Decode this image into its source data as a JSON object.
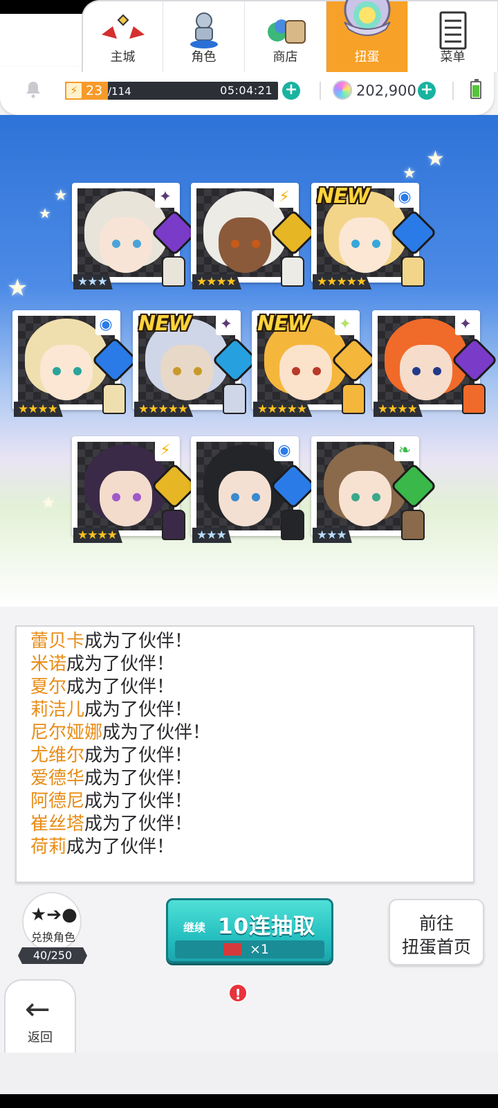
{
  "hud": {
    "stamina_current": "23",
    "stamina_max": "/114",
    "stamina_fraction": 0.2,
    "timer": "05:04:21",
    "gems": "202,900",
    "bolt_icon": "⚡"
  },
  "cards": [
    {
      "row": 1,
      "rarity": "★★★",
      "silver": true,
      "new": "",
      "element": "dark",
      "badge": "✦",
      "badge_color": "#5a3a78",
      "hair": "#e9e4da",
      "skin": "#f8e4d6",
      "eye": "#4aa3d8",
      "gem": "#7a3bc8"
    },
    {
      "row": 1,
      "rarity": "★★★★",
      "silver": false,
      "new": "",
      "element": "light",
      "badge": "⚡",
      "badge_color": "#f2b200",
      "hair": "#ecebe6",
      "skin": "#8b5a3a",
      "eye": "#c85a18",
      "gem": "#e7b625"
    },
    {
      "row": 1,
      "rarity": "★★★★★",
      "silver": false,
      "new": "NEW",
      "element": "water",
      "badge": "◉",
      "badge_color": "#2a7be8",
      "hair": "#f3d58a",
      "skin": "#fbe7d4",
      "eye": "#38a6d8",
      "gem": "#2a7be8"
    },
    {
      "row": 2,
      "rarity": "★★★★",
      "silver": false,
      "new": "",
      "element": "water",
      "badge": "◉",
      "badge_color": "#2a7be8",
      "hair": "#f0dfae",
      "skin": "#fbe7d4",
      "eye": "#2aa49a",
      "gem": "#2a7be8"
    },
    {
      "row": 2,
      "rarity": "★★★★★",
      "silver": false,
      "new": "NEW",
      "element": "dark",
      "badge": "✦",
      "badge_color": "#5a3a78",
      "hair": "#cfd6e8",
      "skin": "#e8d8c8",
      "eye": "#c89a2a",
      "gem": "#27a0e0"
    },
    {
      "row": 2,
      "rarity": "★★★★★",
      "silver": false,
      "new": "NEW",
      "element": "light",
      "badge": "✦",
      "badge_color": "#b7e06a",
      "hair": "#f5b63c",
      "skin": "#fbe2cb",
      "eye": "#b83a28",
      "gem": "#f5b63c"
    },
    {
      "row": 2,
      "rarity": "★★★★",
      "silver": false,
      "new": "",
      "element": "dark",
      "badge": "✦",
      "badge_color": "#5a3a78",
      "hair": "#f06a2a",
      "skin": "#f6dccb",
      "eye": "#233a8a",
      "gem": "#7a3bc8"
    },
    {
      "row": 3,
      "rarity": "★★★★",
      "silver": false,
      "new": "",
      "element": "light",
      "badge": "⚡",
      "badge_color": "#f2b200",
      "hair": "#3a2a48",
      "skin": "#f3dccc",
      "eye": "#a05ac8",
      "gem": "#e7b625"
    },
    {
      "row": 3,
      "rarity": "★★★",
      "silver": true,
      "new": "",
      "element": "water",
      "badge": "◉",
      "badge_color": "#2a7be8",
      "hair": "#232529",
      "skin": "#f4e0d2",
      "eye": "#3a8ad0",
      "gem": "#2a7be8"
    },
    {
      "row": 3,
      "rarity": "★★★",
      "silver": true,
      "new": "",
      "element": "wind",
      "badge": "❧",
      "badge_color": "#3bb84a",
      "hair": "#8a6a4a",
      "skin": "#f7e2d2",
      "eye": "#3aa88a",
      "gem": "#3bb84a"
    }
  ],
  "log": [
    {
      "name": "蕾贝卡",
      "suffix": "成为了伙伴！"
    },
    {
      "name": "米诺",
      "suffix": "成为了伙伴！"
    },
    {
      "name": "夏尔",
      "suffix": "成为了伙伴！"
    },
    {
      "name": "莉洁儿",
      "suffix": "成为了伙伴！"
    },
    {
      "name": "尼尔娅娜",
      "suffix": "成为了伙伴！"
    },
    {
      "name": "尤维尔",
      "suffix": "成为了伙伴！"
    },
    {
      "name": "爱德华",
      "suffix": "成为了伙伴！"
    },
    {
      "name": "阿德尼",
      "suffix": "成为了伙伴！"
    },
    {
      "name": "崔丝塔",
      "suffix": "成为了伙伴！"
    },
    {
      "name": "荷莉",
      "suffix": "成为了伙伴！"
    }
  ],
  "swap": {
    "label": "兑换角色",
    "count": "40/250"
  },
  "pull": {
    "continue_label": "继续",
    "main_label": "10连抽取",
    "cost": "×1"
  },
  "goto": {
    "line1": "前往",
    "line2": "扭蛋首页"
  },
  "nav": {
    "back": "返回",
    "items": [
      "主城",
      "角色",
      "商店",
      "扭蛋",
      "菜单"
    ],
    "alert": "!"
  }
}
